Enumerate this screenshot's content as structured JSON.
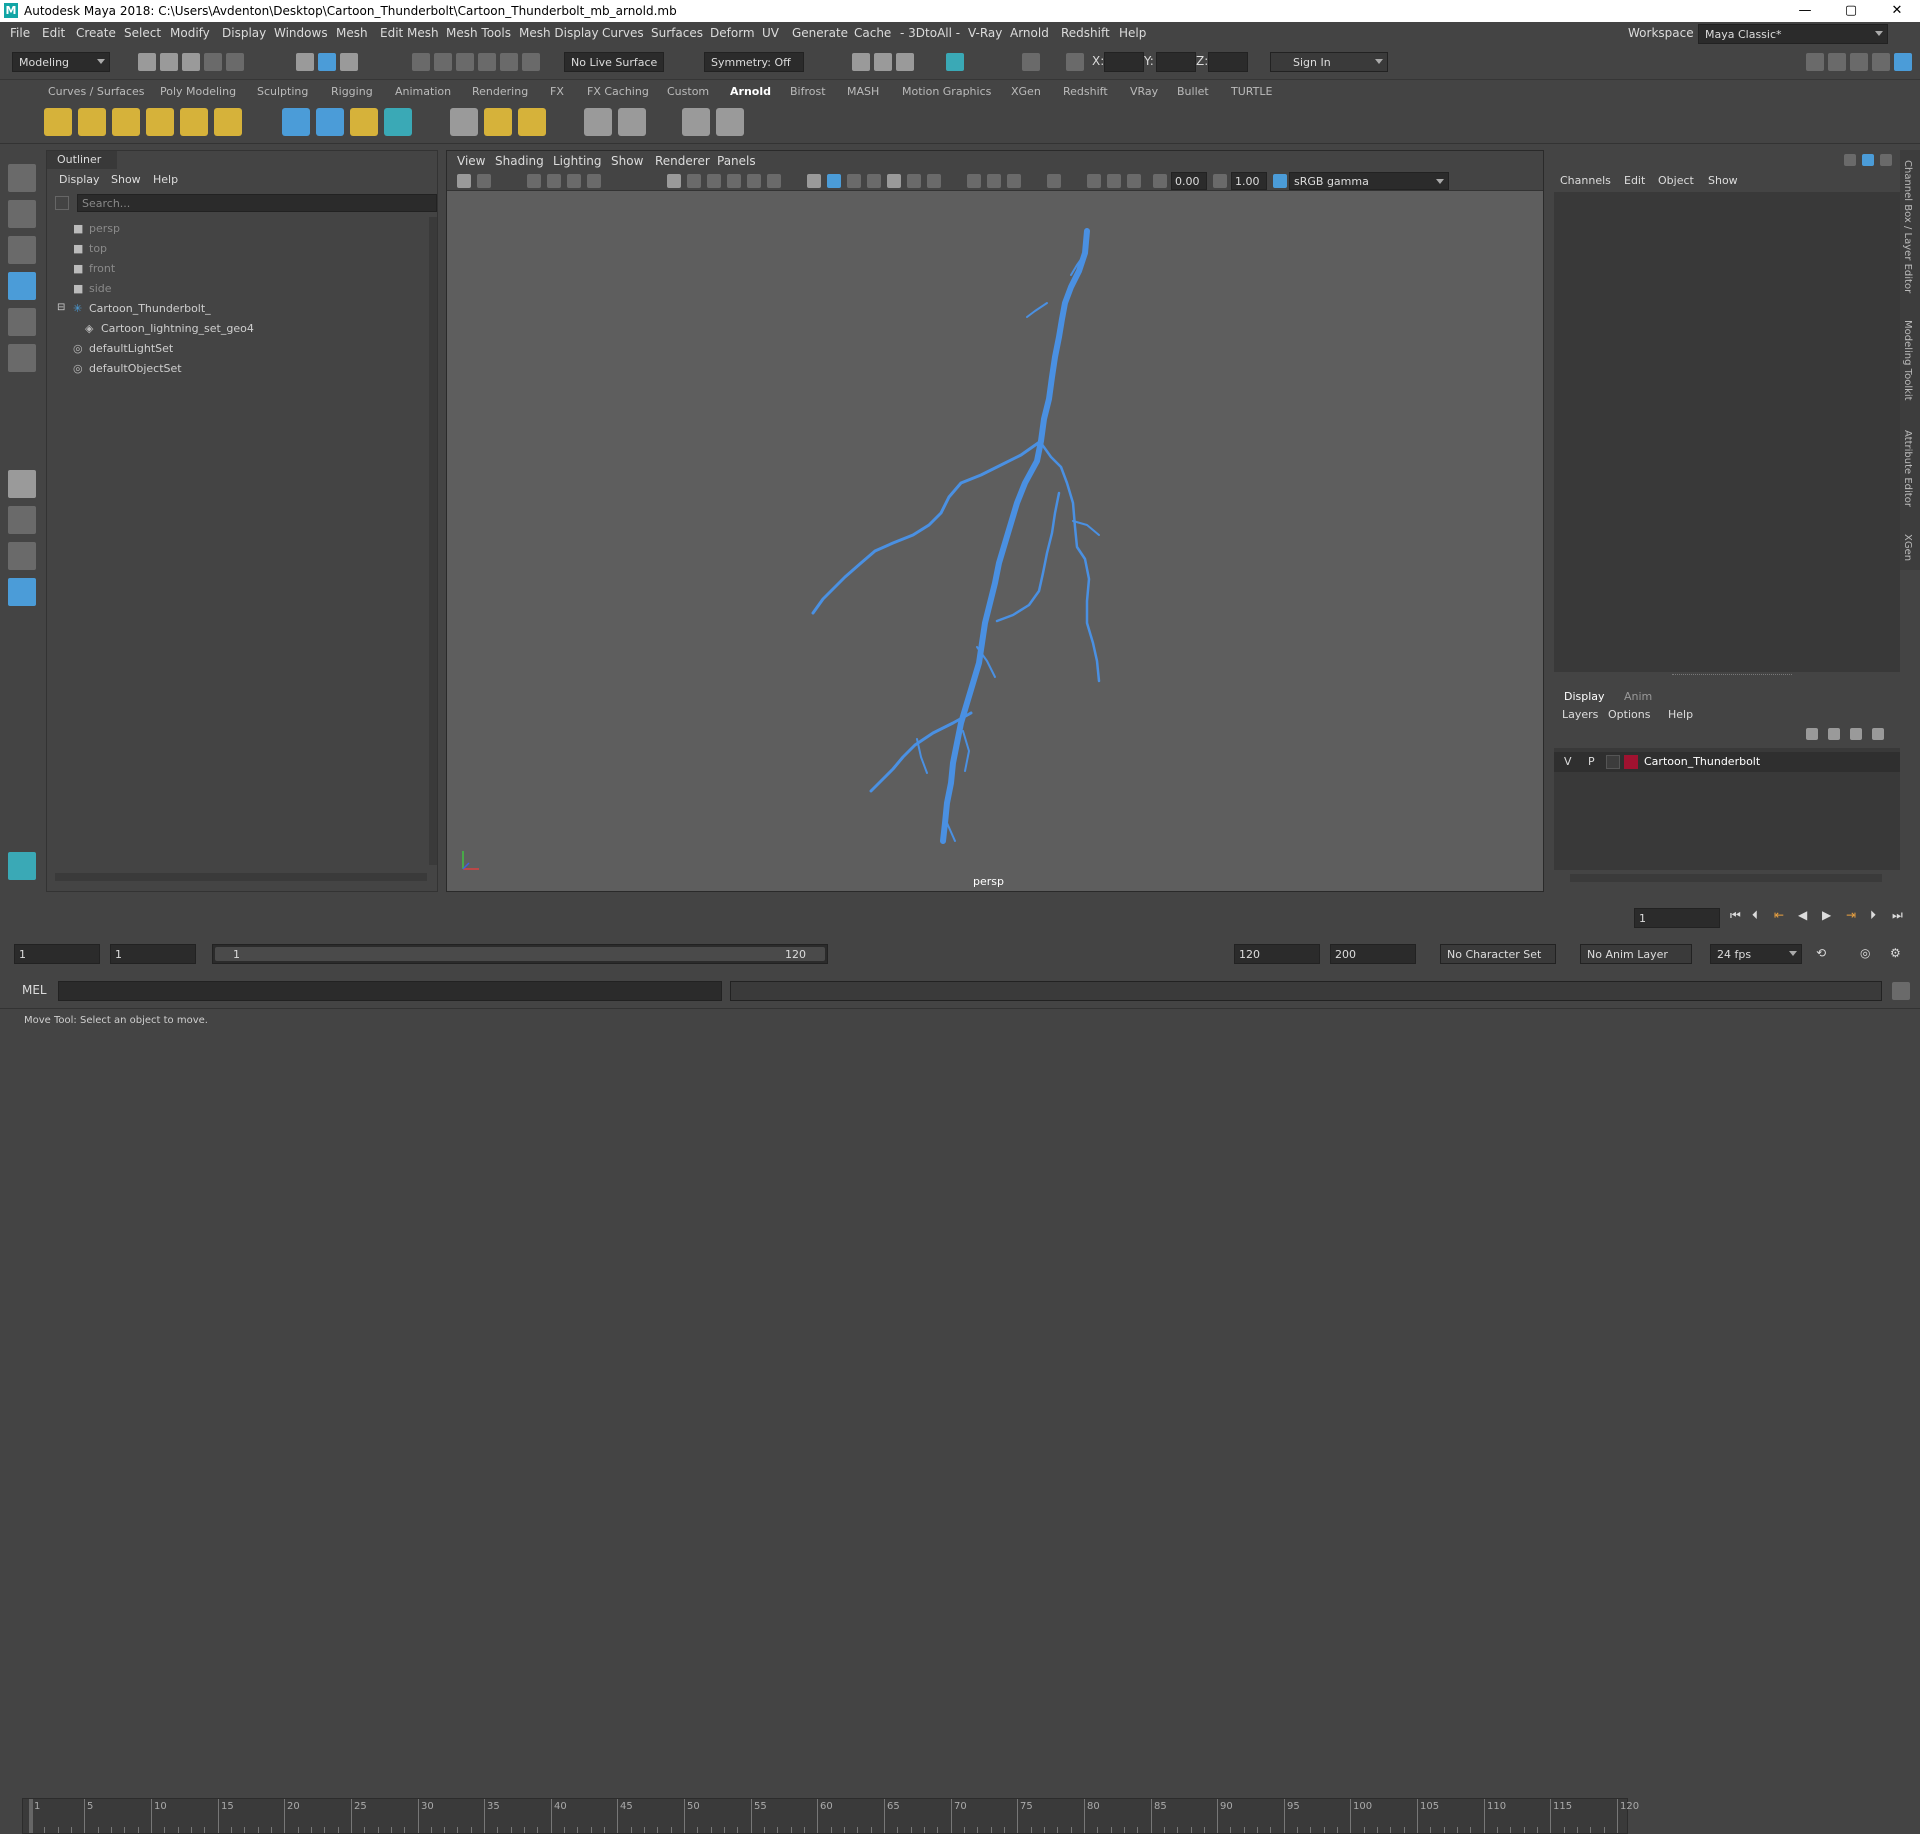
{
  "window": {
    "title": "Autodesk Maya 2018: C:\\Users\\Avdenton\\Desktop\\Cartoon_Thunderbolt\\Cartoon_Thunderbolt_mb_arnold.mb",
    "logo": "M",
    "minimize": "—",
    "maximize": "▢",
    "close": "✕"
  },
  "menubar": {
    "items": [
      "File",
      "Edit",
      "Create",
      "Select",
      "Modify",
      "Display",
      "Windows",
      "Mesh",
      "Edit Mesh",
      "Mesh Tools",
      "Mesh Display",
      "Curves",
      "Surfaces",
      "Deform",
      "UV",
      "Generate",
      "Cache",
      "- 3DtoAll -",
      "V-Ray",
      "Arnold",
      "Redshift",
      "Help"
    ],
    "workspace_label": "Workspace :",
    "workspace_value": "Maya Classic*"
  },
  "statusline": {
    "mode": "Modeling",
    "live_surface": "No Live Surface",
    "symmetry": "Symmetry: Off",
    "x_label": "X:",
    "y_label": "Y:",
    "z_label": "Z:",
    "sign_in": "Sign In"
  },
  "shelf": {
    "tabs": [
      "Curves / Surfaces",
      "Poly Modeling",
      "Sculpting",
      "Rigging",
      "Animation",
      "Rendering",
      "FX",
      "FX Caching",
      "Custom",
      "Arnold",
      "Bifrost",
      "MASH",
      "Motion Graphics",
      "XGen",
      "Redshift",
      "VRay",
      "Bullet",
      "TURTLE"
    ],
    "active_tab": "Arnold"
  },
  "outliner": {
    "tab": "Outliner",
    "menus": [
      "Display",
      "Show",
      "Help"
    ],
    "search_placeholder": "Search...",
    "items": [
      {
        "label": "persp",
        "dim": true,
        "indent": 0,
        "icon": "camera-icon"
      },
      {
        "label": "top",
        "dim": true,
        "indent": 0,
        "icon": "camera-icon"
      },
      {
        "label": "front",
        "dim": true,
        "indent": 0,
        "icon": "camera-icon"
      },
      {
        "label": "side",
        "dim": true,
        "indent": 0,
        "icon": "camera-icon"
      },
      {
        "label": "Cartoon_Thunderbolt_",
        "dim": false,
        "indent": 0,
        "icon": "group-icon"
      },
      {
        "label": "Cartoon_lightning_set_geo4",
        "dim": false,
        "indent": 1,
        "icon": "mesh-icon"
      },
      {
        "label": "defaultLightSet",
        "dim": false,
        "indent": 0,
        "icon": "set-icon"
      },
      {
        "label": "defaultObjectSet",
        "dim": false,
        "indent": 0,
        "icon": "set-icon"
      }
    ]
  },
  "viewport": {
    "menus": [
      "View",
      "Shading",
      "Lighting",
      "Show",
      "Renderer",
      "Panels"
    ],
    "exposure": "0.00",
    "gamma": "1.00",
    "color_space": "sRGB gamma",
    "camera_label": "persp"
  },
  "channelbox": {
    "menus": [
      "Channels",
      "Edit",
      "Object",
      "Show"
    ]
  },
  "layers": {
    "tabs": [
      "Display",
      "Anim"
    ],
    "menus": [
      "Layers",
      "Options",
      "Help"
    ],
    "layer": {
      "v": "V",
      "p": "P",
      "name": "Cartoon_Thunderbolt",
      "color": "#a01230"
    }
  },
  "side_tabs": [
    "Channel Box / Layer Editor",
    "Modeling Toolkit",
    "Attribute Editor",
    "XGen"
  ],
  "timeline": {
    "ticks": [
      1,
      5,
      10,
      15,
      20,
      25,
      30,
      35,
      40,
      45,
      50,
      55,
      60,
      65,
      70,
      75,
      80,
      85,
      90,
      95,
      100,
      105,
      110,
      115,
      120
    ],
    "current_frame": "1"
  },
  "range": {
    "start": "1",
    "playback_start": "1",
    "slider_start": "1",
    "slider_end": "120",
    "playback_end": "120",
    "end": "200",
    "character_set": "No Character Set",
    "anim_layer": "No Anim Layer",
    "fps": "24 fps"
  },
  "command": {
    "language": "MEL"
  },
  "help_line": "Move Tool: Select an object to move.",
  "colors": {
    "accent_blue": "#4b9cd8",
    "lightning": "#4a90e2"
  }
}
